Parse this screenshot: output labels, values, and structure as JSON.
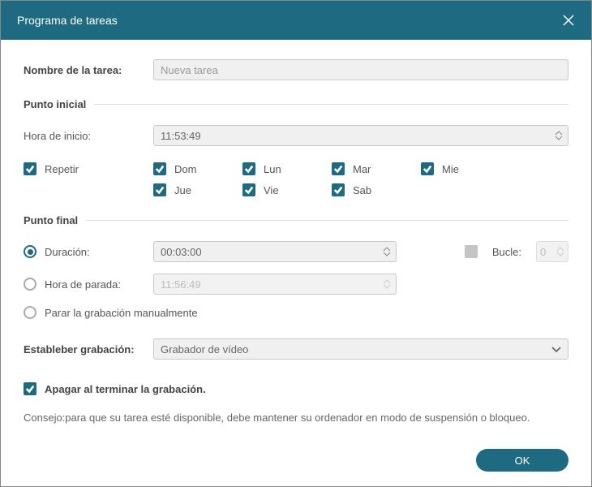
{
  "title": "Programa de tareas",
  "task_name_label": "Nombre de la tarea:",
  "task_name_placeholder": "Nueva tarea",
  "section_start": "Punto inicial",
  "start_time_label": "Hora de inicio:",
  "start_time_value": "11:53:49",
  "repeat_label": "Repetir",
  "days": {
    "dom": "Dom",
    "lun": "Lun",
    "mar": "Mar",
    "mie": "Mie",
    "jue": "Jue",
    "vie": "Vie",
    "sab": "Sab"
  },
  "section_end": "Punto final",
  "duration_label": "Duración:",
  "duration_value": "00:03:00",
  "loop_label": "Bucle:",
  "loop_value": "0",
  "stoptime_label": "Hora de parada:",
  "stoptime_value": "11:56:49",
  "manual_stop_label": "Parar la grabación manualmente",
  "recorder_label": "Estableber grabación:",
  "recorder_value": "Grabador de vídeo",
  "shutdown_label": "Apagar al terminar la grabación.",
  "tip_text": "Consejo:para que su tarea esté disponible, debe mantener su ordenador en modo de suspensión o bloqueo.",
  "ok_label": "OK",
  "colors": {
    "accent": "#1d6a81"
  }
}
